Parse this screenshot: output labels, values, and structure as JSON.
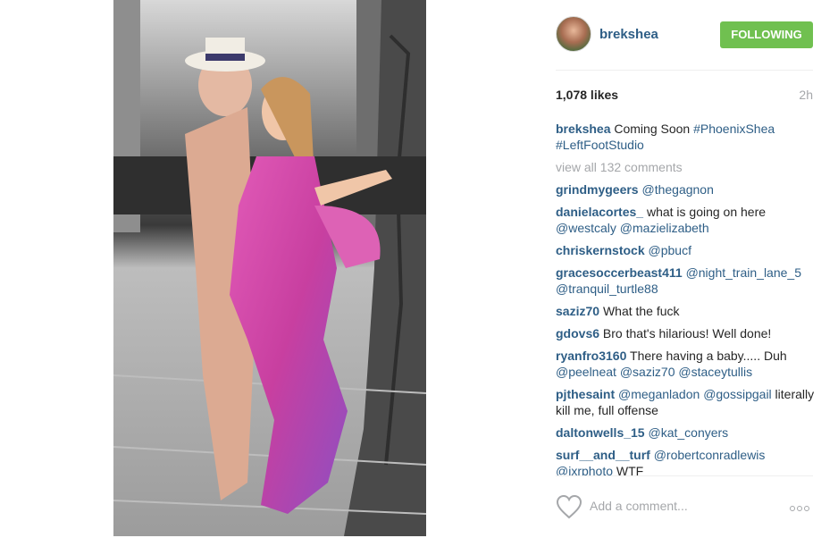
{
  "header": {
    "username": "brekshea",
    "follow_label": "FOLLOWING"
  },
  "stats": {
    "likes": "1,078 likes",
    "time": "2h"
  },
  "caption": {
    "user": "brekshea",
    "text": " Coming Soon ",
    "tag1": "#PhoenixShea",
    "tag2": "#LeftFootStudio"
  },
  "view_all": "view all 132 comments",
  "comments": [
    {
      "user": "grindmygeers",
      "parts": [
        {
          "type": "mention",
          "text": "@thegagnon"
        }
      ]
    },
    {
      "user": "danielacortes_",
      "parts": [
        {
          "type": "text",
          "text": "what is going on here "
        },
        {
          "type": "mention",
          "text": "@westcaly"
        },
        {
          "type": "text",
          "text": " "
        },
        {
          "type": "mention",
          "text": "@mazielizabeth"
        }
      ]
    },
    {
      "user": "chriskernstock",
      "parts": [
        {
          "type": "mention",
          "text": "@pbucf"
        }
      ]
    },
    {
      "user": "gracesoccerbeast411",
      "parts": [
        {
          "type": "mention",
          "text": "@night_train_lane_5"
        },
        {
          "type": "text",
          "text": " "
        },
        {
          "type": "mention",
          "text": "@tranquil_turtle88"
        }
      ]
    },
    {
      "user": "saziz70",
      "parts": [
        {
          "type": "text",
          "text": "What the fuck"
        }
      ]
    },
    {
      "user": "gdovs6",
      "parts": [
        {
          "type": "text",
          "text": "Bro that's hilarious! Well done!"
        }
      ]
    },
    {
      "user": "ryanfro3160",
      "parts": [
        {
          "type": "text",
          "text": "There having a baby..... Duh "
        },
        {
          "type": "mention",
          "text": "@peelneat"
        },
        {
          "type": "text",
          "text": " "
        },
        {
          "type": "mention",
          "text": "@saziz70"
        },
        {
          "type": "text",
          "text": " "
        },
        {
          "type": "mention",
          "text": "@staceytullis"
        }
      ]
    },
    {
      "user": "pjthesaint",
      "parts": [
        {
          "type": "mention",
          "text": "@meganladon"
        },
        {
          "type": "text",
          "text": " "
        },
        {
          "type": "mention",
          "text": "@gossipgail"
        },
        {
          "type": "text",
          "text": " literally kill me, full offense"
        }
      ]
    },
    {
      "user": "daltonwells_15",
      "parts": [
        {
          "type": "mention",
          "text": "@kat_conyers"
        }
      ]
    },
    {
      "user": "surf__and__turf",
      "parts": [
        {
          "type": "mention",
          "text": "@robertconradlewis"
        },
        {
          "type": "text",
          "text": " "
        },
        {
          "type": "mention",
          "text": "@jxrphoto"
        },
        {
          "type": "text",
          "text": " WTF"
        }
      ]
    }
  ],
  "footer": {
    "placeholder": "Add a comment..."
  },
  "icons": {
    "heart": "heart-icon",
    "more": "more-options-icon"
  },
  "colors": {
    "follow_bg": "#70c050",
    "link": "#2e5e86",
    "muted": "#a5a7aa"
  }
}
